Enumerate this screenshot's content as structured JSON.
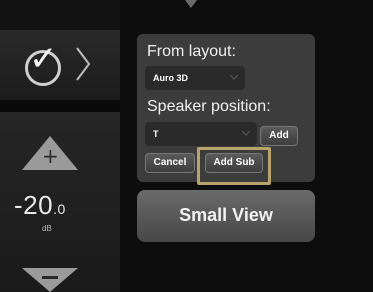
{
  "panel": {
    "layout_label": "From layout:",
    "layout_value": "Auro 3D",
    "position_label": "Speaker position:",
    "position_value": "T",
    "add_label": "Add",
    "cancel_label": "Cancel",
    "add_sub_label": "Add Sub"
  },
  "small_view_label": "Small View",
  "volume": {
    "value": "-20",
    "decimal": ".0",
    "unit": "dB"
  },
  "colors": {
    "highlight": "#b8a46a",
    "panel": "#3c3c3c"
  },
  "icons": [
    "check-icon",
    "chevron-right-icon",
    "plus-icon",
    "minus-icon",
    "dropdown-arrow-icon"
  ]
}
